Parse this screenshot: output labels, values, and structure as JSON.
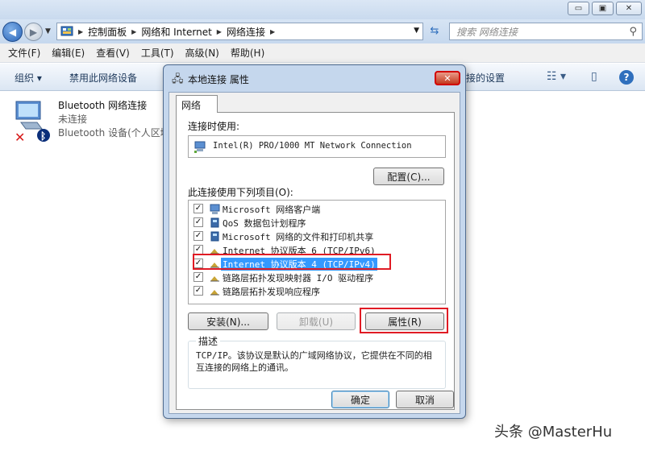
{
  "window": {
    "controls": {
      "minimize": "▭",
      "maximize": "▣",
      "close": "✕"
    }
  },
  "address": {
    "crumbs": [
      "控制面板",
      "网络和 Internet",
      "网络连接"
    ],
    "search_placeholder": "搜索 网络连接"
  },
  "menu": [
    "文件(F)",
    "编辑(E)",
    "查看(V)",
    "工具(T)",
    "高级(N)",
    "帮助(H)"
  ],
  "command_bar": {
    "organize": "组织 ▾",
    "disable": "禁用此网络设备",
    "settings_partial": "接的设置"
  },
  "connection": {
    "name": "Bluetooth 网络连接",
    "status": "未连接",
    "device": "Bluetooth 设备(个人区域"
  },
  "dialog": {
    "title": "本地连接 属性",
    "close": "✕",
    "tab": "网络",
    "connect_using_label": "连接时使用:",
    "adapter": "Intel(R) PRO/1000 MT Network Connection",
    "configure_button": "配置(C)...",
    "items_label": "此连接使用下列项目(O):",
    "items": [
      {
        "label": "Microsoft 网络客户端",
        "checked": true
      },
      {
        "label": "QoS 数据包计划程序",
        "checked": true
      },
      {
        "label": "Microsoft 网络的文件和打印机共享",
        "checked": true
      },
      {
        "label": "Internet 协议版本 6 (TCP/IPv6)",
        "checked": true
      },
      {
        "label": "Internet 协议版本 4 (TCP/IPv4)",
        "checked": true,
        "selected": true
      },
      {
        "label": "链路层拓扑发现映射器 I/O 驱动程序",
        "checked": true
      },
      {
        "label": "链路层拓扑发现响应程序",
        "checked": true
      }
    ],
    "install_button": "安装(N)...",
    "uninstall_button": "卸载(U)",
    "properties_button": "属性(R)",
    "description_label": "描述",
    "description_text": "TCP/IP。该协议是默认的广域网络协议，它提供在不同的相互连接的网络上的通讯。",
    "ok_button": "确定",
    "cancel_button": "取消"
  },
  "watermark": "头条 @MasterHu",
  "colors": {
    "selection": "#3399ff",
    "highlight_box": "#e01b24"
  }
}
